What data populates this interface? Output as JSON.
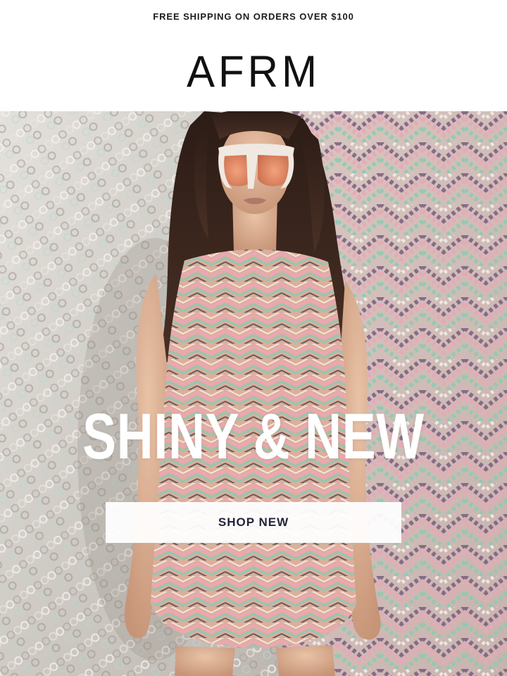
{
  "promo": {
    "text": "FREE SHIPPING ON ORDERS OVER $100"
  },
  "brand": {
    "logo": "AFRM"
  },
  "hero": {
    "headline": "SHINY & NEW",
    "cta_label": "SHOP NEW",
    "image_alt": "Model in sequined chevron mini dress and white sunglasses against sequin backdrop"
  },
  "colors": {
    "background": "#ffffff",
    "text": "#1a1a1a",
    "headline": "#ffffff",
    "button_bg": "#ffffff",
    "button_text": "#23233a",
    "sequin_pink": "#e7a9b4",
    "sequin_mint": "#8fc9ad",
    "sequin_purple": "#8a6b8e",
    "sequin_silver": "#c9c6c2"
  }
}
